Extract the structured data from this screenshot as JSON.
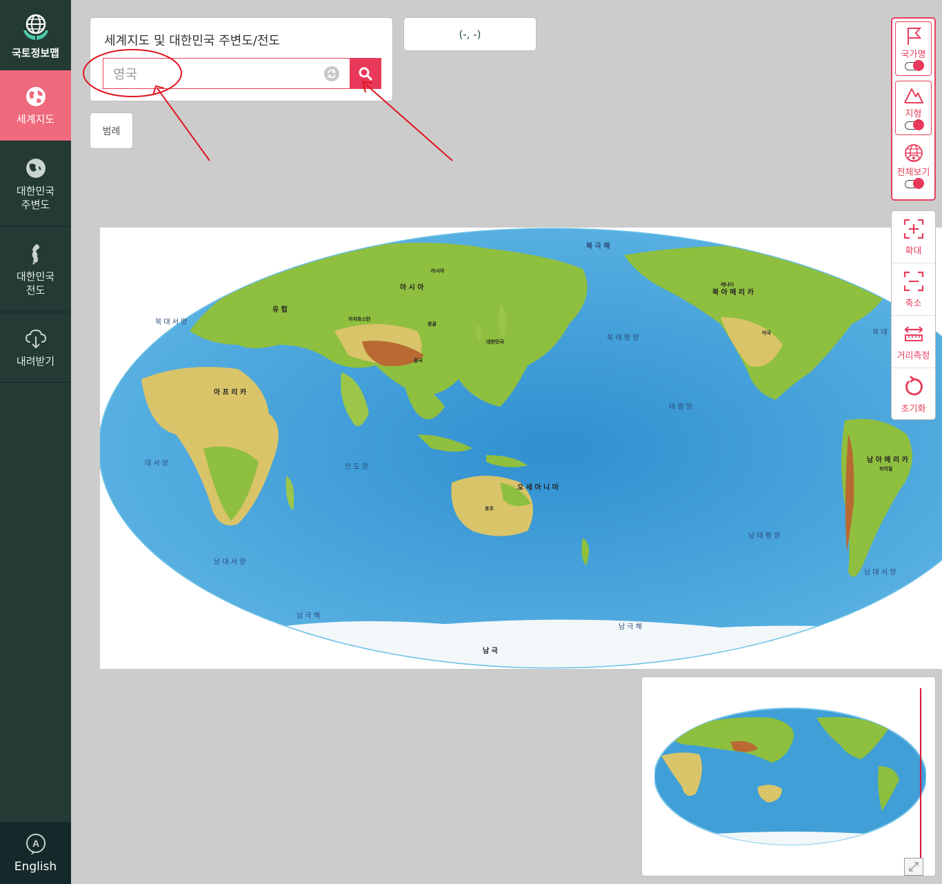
{
  "sidebar": {
    "brand_label": "국토정보맵",
    "items": [
      {
        "label": "세계지도",
        "icon": "globe-icon"
      },
      {
        "label": "대한민국\n주변도",
        "icon": "globe-east-asia-icon"
      },
      {
        "label": "대한민국\n전도",
        "icon": "korea-peninsula-icon"
      },
      {
        "label": "내려받기",
        "icon": "cloud-download-icon"
      }
    ],
    "language_label": "English"
  },
  "search": {
    "title": "세계지도 및 대한민국 주변도/전도",
    "value": "영국",
    "placeholder": "영국"
  },
  "coordinates": "(-, -)",
  "legend_label": "범례",
  "layers": [
    {
      "label": "국가명",
      "icon": "flag-icon",
      "on": true
    },
    {
      "label": "지형",
      "icon": "mountain-icon",
      "on": true
    },
    {
      "label": "전체보기",
      "icon": "globe-eye-icon",
      "on": true
    }
  ],
  "tools": [
    {
      "label": "확대",
      "icon": "zoom-in-icon"
    },
    {
      "label": "축소",
      "icon": "zoom-out-icon"
    },
    {
      "label": "거리측정",
      "icon": "ruler-icon"
    },
    {
      "label": "초기화",
      "icon": "refresh-icon"
    }
  ],
  "map": {
    "labels": {
      "arctic": "북 극 해",
      "asia": "아 시 아",
      "europe": "유 럽",
      "africa": "아 프 리 카",
      "north_america": "북 아 메 리 카",
      "south_america": "남 아 메 리 카",
      "oceania": "오 세 아 니 아",
      "antarctica": "남 극",
      "north_atlantic": "북 대 서 양",
      "atlantic": "대 서 양",
      "south_atlantic": "남 대 서 양",
      "indian_ocean": "인 도 양",
      "north_pacific": "북 태 평 양",
      "pacific": "태 평 양",
      "south_pacific": "남 태 평 양",
      "southern_ocean_left": "남 극 해",
      "southern_ocean_right": "남 극 해",
      "north_atlantic_right": "북 대",
      "south_atlantic_right": "남 대 서 양",
      "korea": "대한민국",
      "china": "중국",
      "russia": "러시아",
      "australia": "호주",
      "usa": "미국",
      "canada": "캐나다",
      "brazil": "브라질",
      "mongolia": "몽골",
      "kazakhstan": "카자흐스탄"
    },
    "colors": {
      "ocean": "#3f9fd6",
      "shallow": "#7fc6ea",
      "land_green": "#8fbf3f",
      "land_yellow": "#d9c46a",
      "land_brown": "#b86a32",
      "ice": "#eef4f8"
    }
  },
  "colors": {
    "accent": "#e8395a",
    "sidebar": "#233a35",
    "sidebar_active": "#ee6a7c"
  }
}
